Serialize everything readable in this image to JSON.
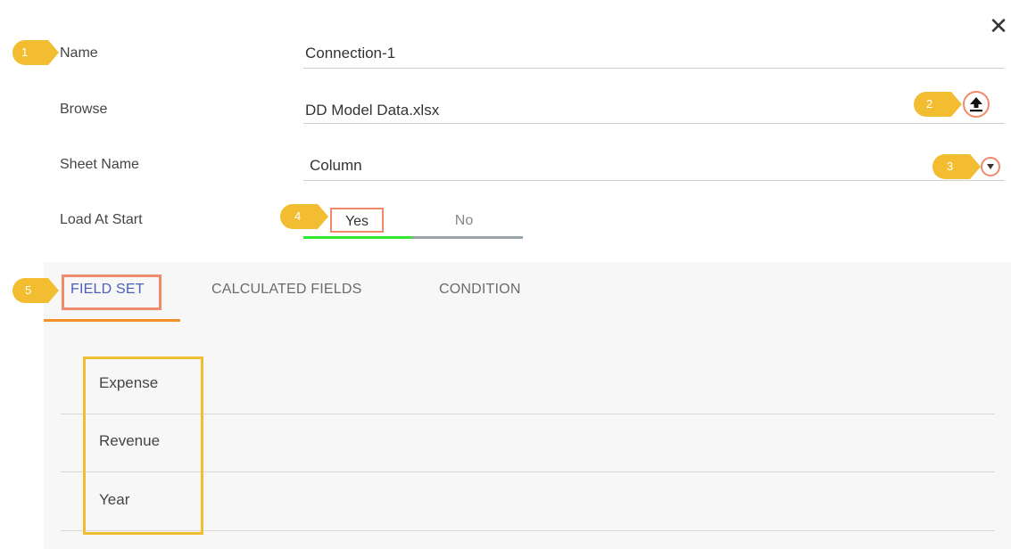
{
  "dialog": {
    "close_glyph": "✕"
  },
  "form": {
    "name_label": "Name",
    "name_value": "Connection-1",
    "browse_label": "Browse",
    "browse_value": "DD Model Data.xlsx",
    "sheet_label": "Sheet Name",
    "sheet_value": "Column",
    "load_label": "Load At Start",
    "load_yes": "Yes",
    "load_no": "No",
    "load_selected": "Yes"
  },
  "callouts": [
    "1",
    "2",
    "3",
    "4",
    "5"
  ],
  "tabs": [
    {
      "label": "FIELD SET",
      "active": true
    },
    {
      "label": "CALCULATED FIELDS",
      "active": false
    },
    {
      "label": "CONDITION",
      "active": false
    }
  ],
  "fields": [
    "Expense",
    "Revenue",
    "Year"
  ],
  "colors": {
    "callout": "#f2bd30",
    "highlight": "#ef8a6a",
    "toggle_on": "#32e832",
    "tab_active": "#4a5fb8",
    "tab_underline": "#f0912a"
  },
  "icons": {
    "close": "close-icon",
    "upload": "upload-icon",
    "dropdown": "chevron-down-icon"
  }
}
